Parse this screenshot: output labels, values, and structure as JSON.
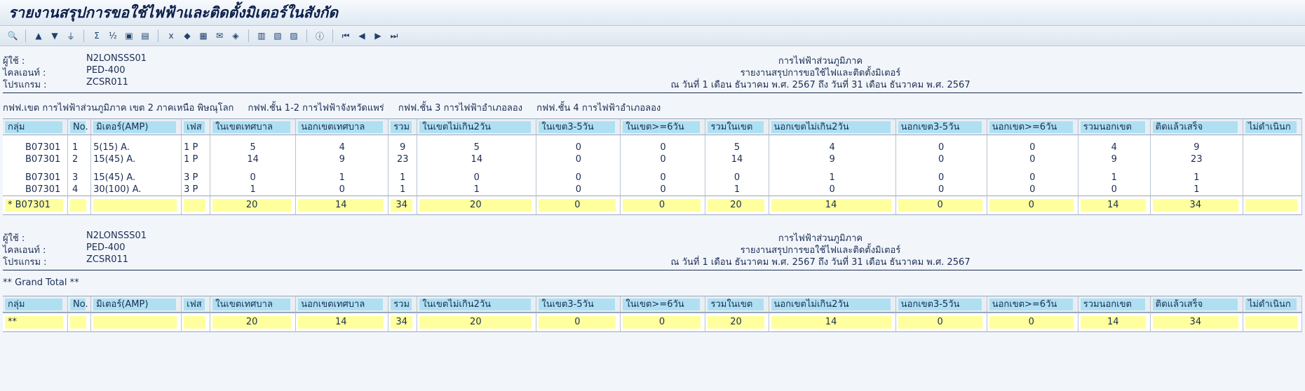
{
  "title": "รายงานสรุปการขอใช้ไฟฟ้าและติดตั้งมิเตอร์ในสังกัด",
  "toolbar_icons": [
    "detail-icon",
    "sort-asc-icon",
    "sort-desc-icon",
    "filter-icon",
    "sum-icon",
    "subtotal-icon",
    "print-preview-icon",
    "layout-icon",
    "export-excel-icon",
    "word-icon",
    "local-file-icon",
    "mail-icon",
    "graphic-icon",
    "change-layout-icon",
    "select-layout-icon",
    "save-layout-icon",
    "info-icon",
    "first-page-icon",
    "prev-page-icon",
    "next-page-icon",
    "last-page-icon"
  ],
  "header": {
    "user_label": "ผู้ใช้    :",
    "user": "N2LONSSS01",
    "client_label": "ไคลเอนท์  :",
    "client": "PED-400",
    "program_label": "โปรแกรม   :",
    "program": "ZCSR011",
    "org": "การไฟฟ้าส่วนภูมิภาค",
    "report": "รายงานสรุปการขอใช้ไฟและติดตั้งมิเตอร์",
    "period": "ณ วันที่ 1 เดือน ธันวาคม พ.ศ. 2567 ถึง วันที่ 31 เดือน ธันวาคม พ.ศ. 2567"
  },
  "filter": [
    "กฟฟ.เขต การไฟฟ้าส่วนภูมิภาค เขต 2 ภาคเหนือ พิษณุโลก",
    "กฟฟ.ชั้น 1-2 การไฟฟ้าจังหวัดแพร่",
    "กฟฟ.ชั้น 3 การไฟฟ้าอำเภอลอง",
    "กฟฟ.ชั้น 4 การไฟฟ้าอำเภอลอง"
  ],
  "columns": [
    "กลุ่ม",
    "No.",
    "มิเตอร์(AMP)",
    "เฟส",
    "ในเขตเทศบาล",
    "นอกเขตเทศบาล",
    "รวม",
    "ในเขตไม่เกิน2วัน",
    "ในเขต3-5วัน",
    "ในเขต>=6วัน",
    "รวมในเขต",
    "นอกเขตไม่เกิน2วัน",
    "นอกเขต3-5วัน",
    "นอกเขต>=6วัน",
    "รวมนอกเขต",
    "ติดแล้วเสร็จ",
    "ไม่ดำเนินก"
  ],
  "rows_a": [
    [
      "B07301",
      "1",
      "5(15) A.",
      "1 P",
      "5",
      "4",
      "9",
      "5",
      "0",
      "0",
      "5",
      "4",
      "0",
      "0",
      "4",
      "9",
      ""
    ],
    [
      "B07301",
      "2",
      "15(45) A.",
      "1 P",
      "14",
      "9",
      "23",
      "14",
      "0",
      "0",
      "14",
      "9",
      "0",
      "0",
      "9",
      "23",
      ""
    ]
  ],
  "rows_b": [
    [
      "B07301",
      "3",
      "15(45) A.",
      "3 P",
      "0",
      "1",
      "1",
      "0",
      "0",
      "0",
      "0",
      "1",
      "0",
      "0",
      "1",
      "1",
      ""
    ],
    [
      "B07301",
      "4",
      "30(100) A.",
      "3 P",
      "1",
      "0",
      "1",
      "1",
      "0",
      "0",
      "1",
      "0",
      "0",
      "0",
      "0",
      "1",
      ""
    ]
  ],
  "subtotal": [
    "*   B07301",
    "",
    "",
    "",
    "20",
    "14",
    "34",
    "20",
    "0",
    "0",
    "20",
    "14",
    "0",
    "0",
    "14",
    "34",
    ""
  ],
  "grand_title": "** Grand Total **",
  "grand": [
    "**",
    "",
    "",
    "",
    "20",
    "14",
    "34",
    "20",
    "0",
    "0",
    "20",
    "14",
    "0",
    "0",
    "14",
    "34",
    ""
  ]
}
